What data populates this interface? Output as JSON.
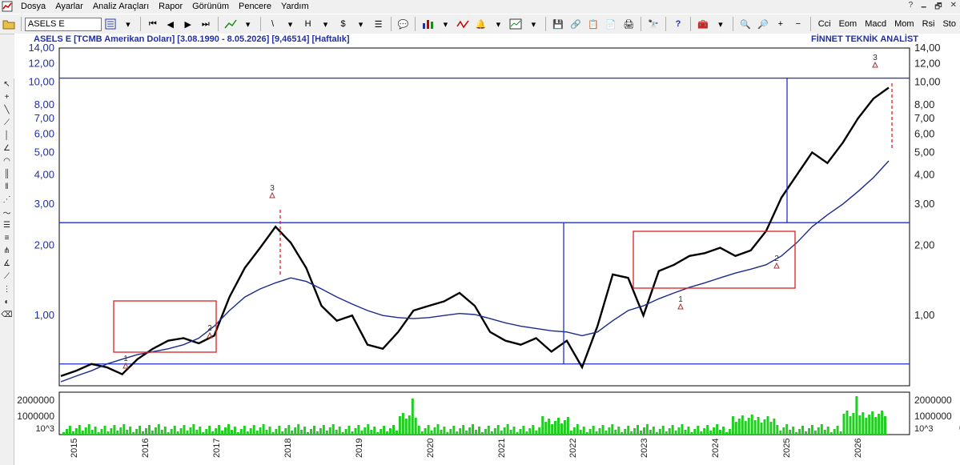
{
  "menu": [
    "Dosya",
    "Ayarlar",
    "Analiz Araçları",
    "Rapor",
    "Görünüm",
    "Pencere",
    "Yardım"
  ],
  "window_controls": [
    "?",
    "🗕",
    "🗗",
    "✕"
  ],
  "toolbar": {
    "symbol_value": "ASELS E",
    "indicator_buttons": [
      "Cci",
      "Eom",
      "Macd",
      "Mom",
      "Rsi",
      "Sto"
    ]
  },
  "chart": {
    "header_left": "ASELS E  [TCMB Amerikan Doları]  [3.08.1990 - 8.05.2026]  [9,46514]  [Haftalık]",
    "header_right": "FİNNET TEKNİK ANALİST",
    "y_ticks": [
      "14,00",
      "12,00",
      "10,00",
      "8,00",
      "7,00",
      "6,00",
      "5,00",
      "4,00",
      "3,00",
      "2,00",
      "1,00"
    ],
    "volume_ticks_left": [
      "2000000",
      "1000000",
      "10^3"
    ],
    "volume_ticks_right": [
      "2000000",
      "1000000",
      "0",
      "10^3"
    ],
    "x_ticks": [
      "2015",
      "2016",
      "2017",
      "2018",
      "2019",
      "2020",
      "2021",
      "2022",
      "2023",
      "2024",
      "2025",
      "2026"
    ],
    "wave_labels": [
      "1",
      "2",
      "3",
      "1",
      "2",
      "3"
    ],
    "colors": {
      "price": "#000000",
      "ma": "#1b2a8c",
      "levels": "#1f2fd0",
      "boxes": "#e02020",
      "volume": "#22cc22",
      "text": "#1f2fa8"
    }
  },
  "chart_data": {
    "type": "line",
    "scale": "log",
    "ylim": [
      0.5,
      14
    ],
    "series": [
      {
        "values": [
          0.55,
          0.58,
          0.62,
          0.6,
          0.56,
          0.65,
          0.72,
          0.78,
          0.8,
          0.76,
          0.82,
          1.2,
          1.6,
          1.95,
          2.4,
          2.05,
          1.6,
          1.1,
          0.95,
          1.0,
          0.75,
          0.72,
          0.85,
          1.05,
          1.1,
          1.15,
          1.25,
          1.1,
          0.85,
          0.78,
          0.75,
          0.8,
          0.7,
          0.78,
          0.6,
          0.9,
          1.5,
          1.45,
          1.0,
          1.55,
          1.65,
          1.8,
          1.85,
          1.95,
          1.8,
          1.9,
          2.3,
          3.2,
          4.0,
          5.0,
          4.5,
          5.5,
          7.0,
          8.5,
          9.47
        ]
      },
      {
        "values": [
          0.52,
          0.55,
          0.58,
          0.62,
          0.65,
          0.68,
          0.7,
          0.72,
          0.75,
          0.8,
          0.9,
          1.05,
          1.2,
          1.3,
          1.38,
          1.45,
          1.4,
          1.3,
          1.2,
          1.12,
          1.05,
          1.0,
          0.98,
          0.97,
          0.98,
          1.0,
          1.02,
          1.01,
          0.97,
          0.93,
          0.9,
          0.88,
          0.86,
          0.85,
          0.82,
          0.85,
          0.95,
          1.05,
          1.1,
          1.18,
          1.25,
          1.32,
          1.38,
          1.45,
          1.52,
          1.58,
          1.65,
          1.8,
          2.05,
          2.4,
          2.7,
          3.0,
          3.4,
          3.9,
          4.6
        ]
      }
    ],
    "horizontal_levels": [
      10.4,
      2.5,
      0.62
    ],
    "volume": [
      0,
      0
    ]
  }
}
